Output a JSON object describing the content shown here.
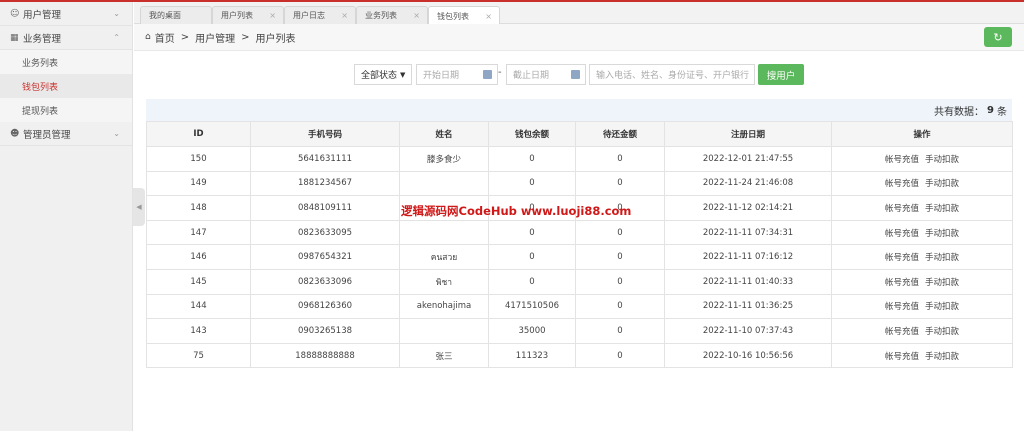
{
  "sidebar": {
    "menus": [
      {
        "label": "用户管理",
        "icon": "user-icon",
        "chevron": "⌄"
      },
      {
        "label": "业务管理",
        "icon": "grid-icon",
        "chevron": "⌃"
      },
      {
        "label": "管理员管理",
        "icon": "admin-user-icon",
        "chevron": "⌄"
      }
    ],
    "sub_items": [
      "业务列表",
      "钱包列表",
      "提现列表"
    ]
  },
  "tabs": [
    "我的桌面",
    "用户列表",
    "用户日志",
    "业务列表",
    "钱包列表"
  ],
  "breadcrumb": {
    "home": "首页",
    "level1": "用户管理",
    "level2": "用户列表"
  },
  "filters": {
    "status_value": "全部状态",
    "start_date_placeholder": "开始日期",
    "end_date_placeholder": "截止日期",
    "keyword_placeholder": "输入电话、姓名、身份证号、开户银行",
    "search_label": "搜用户",
    "dash": "-"
  },
  "summary": {
    "prefix": "共有数据：",
    "count": "9",
    "suffix": "条"
  },
  "table": {
    "headers": [
      "ID",
      "手机号码",
      "姓名",
      "钱包余额",
      "待还金额",
      "注册日期",
      "操作"
    ],
    "action_recharge": "帐号充值",
    "action_deduct": "手动扣款",
    "rows": [
      {
        "id": "150",
        "phone": "5641631111",
        "name": "滕多食少",
        "balance": "0",
        "due": "0",
        "date": "2022-12-01 21:47:55"
      },
      {
        "id": "149",
        "phone": "1881234567",
        "name": "",
        "balance": "0",
        "due": "0",
        "date": "2022-11-24 21:46:08"
      },
      {
        "id": "148",
        "phone": "0848109111",
        "name": "",
        "balance": "0",
        "due": "0",
        "date": "2022-11-12 02:14:21"
      },
      {
        "id": "147",
        "phone": "0823633095",
        "name": "",
        "balance": "0",
        "due": "0",
        "date": "2022-11-11 07:34:31"
      },
      {
        "id": "146",
        "phone": "0987654321",
        "name": "คนสวย",
        "balance": "0",
        "due": "0",
        "date": "2022-11-11 07:16:12"
      },
      {
        "id": "145",
        "phone": "0823633096",
        "name": "พิชา",
        "balance": "0",
        "due": "0",
        "date": "2022-11-11 01:40:33"
      },
      {
        "id": "144",
        "phone": "0968126360",
        "name": "akenohajima",
        "balance": "4171510506",
        "due": "0",
        "date": "2022-11-11 01:36:25"
      },
      {
        "id": "143",
        "phone": "0903265138",
        "name": "",
        "balance": "35000",
        "due": "0",
        "date": "2022-11-10 07:37:43"
      },
      {
        "id": "75",
        "phone": "18888888888",
        "name": "张三",
        "balance": "111323",
        "due": "0",
        "date": "2022-10-16 10:56:56"
      }
    ]
  },
  "watermark": "逻辑源码网CodeHub  www.luoji88.com",
  "colors": {
    "accent": "#c9302c",
    "button": "#5cb85c"
  }
}
